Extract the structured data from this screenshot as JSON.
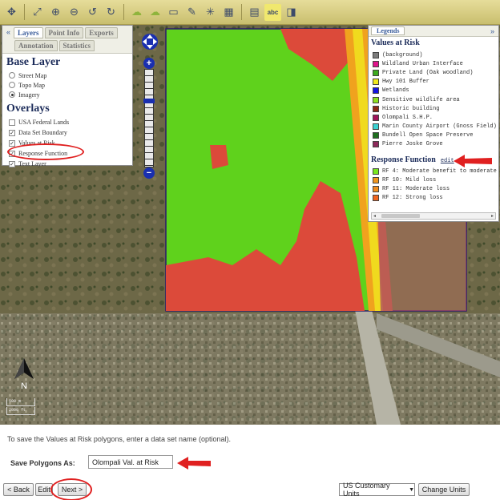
{
  "toolbar": {
    "icons": [
      "pan-globe-icon",
      "zoom-extent-icon",
      "zoom-in-icon",
      "zoom-out-icon",
      "zoom-previous-icon",
      "zoom-next-icon",
      "identify-icon",
      "select-polygon-icon",
      "select-clear-icon",
      "draw-polygon-icon",
      "point-info-icon",
      "table-icon",
      "print-icon",
      "label-icon",
      "fileset-icon"
    ],
    "glyphs": [
      "✥",
      "⤢",
      "⊕",
      "⊖",
      "↺",
      "↻",
      "☁",
      "☁",
      "▭",
      "✎",
      "✳",
      "▦",
      "▤",
      "abc",
      "◨"
    ]
  },
  "layers_panel": {
    "collapse_glyph": "«",
    "tabs": [
      "Layers",
      "Point Info",
      "Exports",
      "Annotation",
      "Statistics"
    ],
    "active_tab": "Layers",
    "base_layer_title": "Base Layer",
    "base_layers": [
      {
        "label": "Street Map",
        "selected": false
      },
      {
        "label": "Topo Map",
        "selected": false
      },
      {
        "label": "Imagery",
        "selected": true
      }
    ],
    "overlays_title": "Overlays",
    "overlays": [
      {
        "label": "USA Federal Lands",
        "checked": false
      },
      {
        "label": "Data Set Boundary",
        "checked": true
      },
      {
        "label": "Values at Risk",
        "checked": true
      },
      {
        "label": "Response Function",
        "checked": true
      },
      {
        "label": "Text Layer",
        "checked": true
      }
    ]
  },
  "zoom": {
    "plus": "+",
    "minus": "−",
    "level_fraction": 0.31
  },
  "legend_panel": {
    "tab": "Legends",
    "expand_glyph": "»",
    "values_title": "Values at Risk",
    "values": [
      {
        "label": "(background)",
        "color": "#7c7c7c"
      },
      {
        "label": "Wildland Urban Interface",
        "color": "#e0148c"
      },
      {
        "label": "Private Land (Oak woodland)",
        "color": "#3caa1e"
      },
      {
        "label": "Hwy 101 Buffer",
        "color": "#f0e81e"
      },
      {
        "label": "Wetlands",
        "color": "#1414e0"
      },
      {
        "label": "Sensitive wildlife area",
        "color": "#8ce01e"
      },
      {
        "label": "Historic building",
        "color": "#8c2814"
      },
      {
        "label": "Olompali S.H.P.",
        "color": "#a0145a"
      },
      {
        "label": "Marin County Airport (Gnoss Field)",
        "color": "#3cd2d2"
      },
      {
        "label": "Bundell Open Space Preserve",
        "color": "#1e6e1e"
      },
      {
        "label": "Pierre Joske Grove",
        "color": "#8c2a5a"
      }
    ],
    "rf_title": "Response Function",
    "rf_edit": "edit",
    "rf_items": [
      {
        "label": "RF 4: Moderate benefit to moderate loss",
        "color": "#78e61e"
      },
      {
        "label": "RF 10: Mild loss",
        "color": "#f0961e"
      },
      {
        "label": "RF 11: Moderate loss",
        "color": "#f08c1e"
      },
      {
        "label": "RF 12: Strong loss",
        "color": "#f0641e"
      }
    ],
    "scroll_left": "◂",
    "scroll_right": "▸"
  },
  "map": {
    "compass_letter": "N",
    "scale_top": "500 m",
    "scale_bottom": "2000 ft"
  },
  "form": {
    "instruction": "To save the Values at Risk polygons, enter a data set name (optional).",
    "save_label": "Save Polygons As:",
    "save_value": "Olompali Val. at Risk",
    "back_label": "< Back",
    "edit_label": "Edit",
    "next_label": "Next >",
    "units_value": "US Customary Units",
    "units_arrow": "▼",
    "change_units_label": "Change Units"
  },
  "colors": {
    "annotation_red": "#e02020",
    "toolbar": "#d8cf85",
    "panel_title": "#1c2c5a",
    "zoom_blue": "#1a2fb0"
  }
}
